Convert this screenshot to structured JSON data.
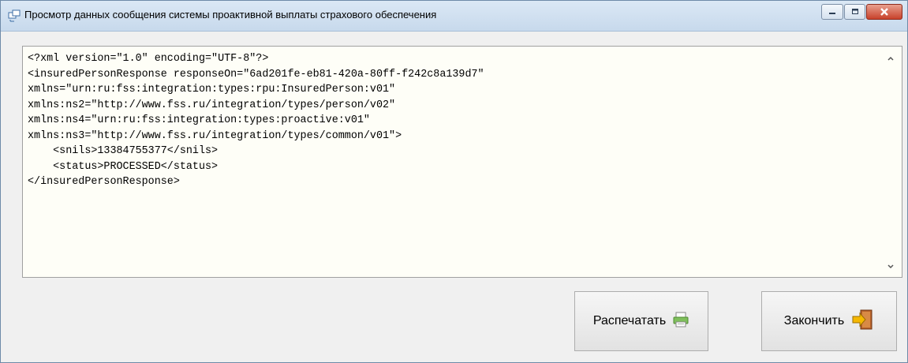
{
  "window": {
    "title": "Просмотр данных сообщения системы проактивной выплаты страхового обеспечения",
    "controls": {
      "minimize_icon": "minimize-icon",
      "maximize_icon": "maximize-icon",
      "close_icon": "close-icon"
    }
  },
  "xml_view": {
    "lines": [
      "<?xml version=\"1.0\" encoding=\"UTF-8\"?>",
      "<insuredPersonResponse responseOn=\"6ad201fe-eb81-420a-80ff-f242c8a139d7\"",
      "xmlns=\"urn:ru:fss:integration:types:rpu:InsuredPerson:v01\"",
      "xmlns:ns2=\"http://www.fss.ru/integration/types/person/v02\"",
      "xmlns:ns4=\"urn:ru:fss:integration:types:proactive:v01\"",
      "xmlns:ns3=\"http://www.fss.ru/integration/types/common/v01\">",
      "    <snils>13384755377</snils>",
      "    <status>PROCESSED</status>",
      "</insuredPersonResponse>"
    ]
  },
  "buttons": {
    "print_label": "Распечатать",
    "finish_label": "Закончить"
  },
  "colors": {
    "text_area_bg": "#fefef7",
    "close_button": "#c8422b"
  }
}
